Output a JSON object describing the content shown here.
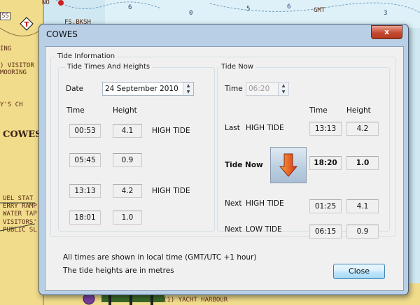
{
  "chart_bg": {
    "labels": {
      "no": "NO",
      "fs_bksh": "FS.BKSH",
      "visitors": ") VISITOR",
      "mooring": "MOORING",
      "ch": "Y'S CH",
      "cowes": "COWES",
      "fuel": "UEL STAT",
      "ferry": "ERRY RAMP",
      "water": "WATER TAP",
      "visitors2": "VISITORS'",
      "public": "PUBLIC SL",
      "ing": "ING",
      "gmt": "GMT",
      "yacht": "(1) YACHT HARBOUR",
      "ss": "SS",
      "d1": "6",
      "d2": "0",
      "d3": "5",
      "d4": "6",
      "d5": "3"
    }
  },
  "dialog": {
    "title": "COWES",
    "close_glyph": "x",
    "tide_information_legend": "Tide Information",
    "times_heights": {
      "legend": "Tide Times And Heights",
      "date_label": "Date",
      "date_value": "24 September 2010",
      "time_header": "Time",
      "height_header": "Height",
      "rows": [
        {
          "time": "00:53",
          "height": "4.1",
          "type": "HIGH TIDE"
        },
        {
          "time": "05:45",
          "height": "0.9",
          "type": ""
        },
        {
          "time": "13:13",
          "height": "4.2",
          "type": "HIGH TIDE"
        },
        {
          "time": "18:01",
          "height": "1.0",
          "type": ""
        }
      ]
    },
    "tide_now": {
      "legend": "Tide Now",
      "time_label": "Time",
      "time_value": "06:20",
      "time_header": "Time",
      "height_header": "Height",
      "last_label": "Last",
      "last_type": "HIGH TIDE",
      "last_time": "13:13",
      "last_height": "4.2",
      "now_label": "Tide Now",
      "now_time": "18:20",
      "now_height": "1.0",
      "next1_label": "Next",
      "next1_type": "HIGH TIDE",
      "next1_time": "01:25",
      "next1_height": "4.1",
      "next2_label": "Next",
      "next2_type": "LOW TIDE",
      "next2_time": "06:15",
      "next2_height": "0.9",
      "arrow_icon": "down-arrow-icon"
    },
    "footer": {
      "note1": "All times are shown in local time (GMT/UTC  +1 hour)",
      "note2": "The tide heights are in metres",
      "close_button": "Close"
    }
  },
  "colors": {
    "window_frame": "#b8cfe6",
    "client_bg": "#f0f0f0",
    "close_red": "#c7492f",
    "arrow_orange": "#e06010"
  }
}
